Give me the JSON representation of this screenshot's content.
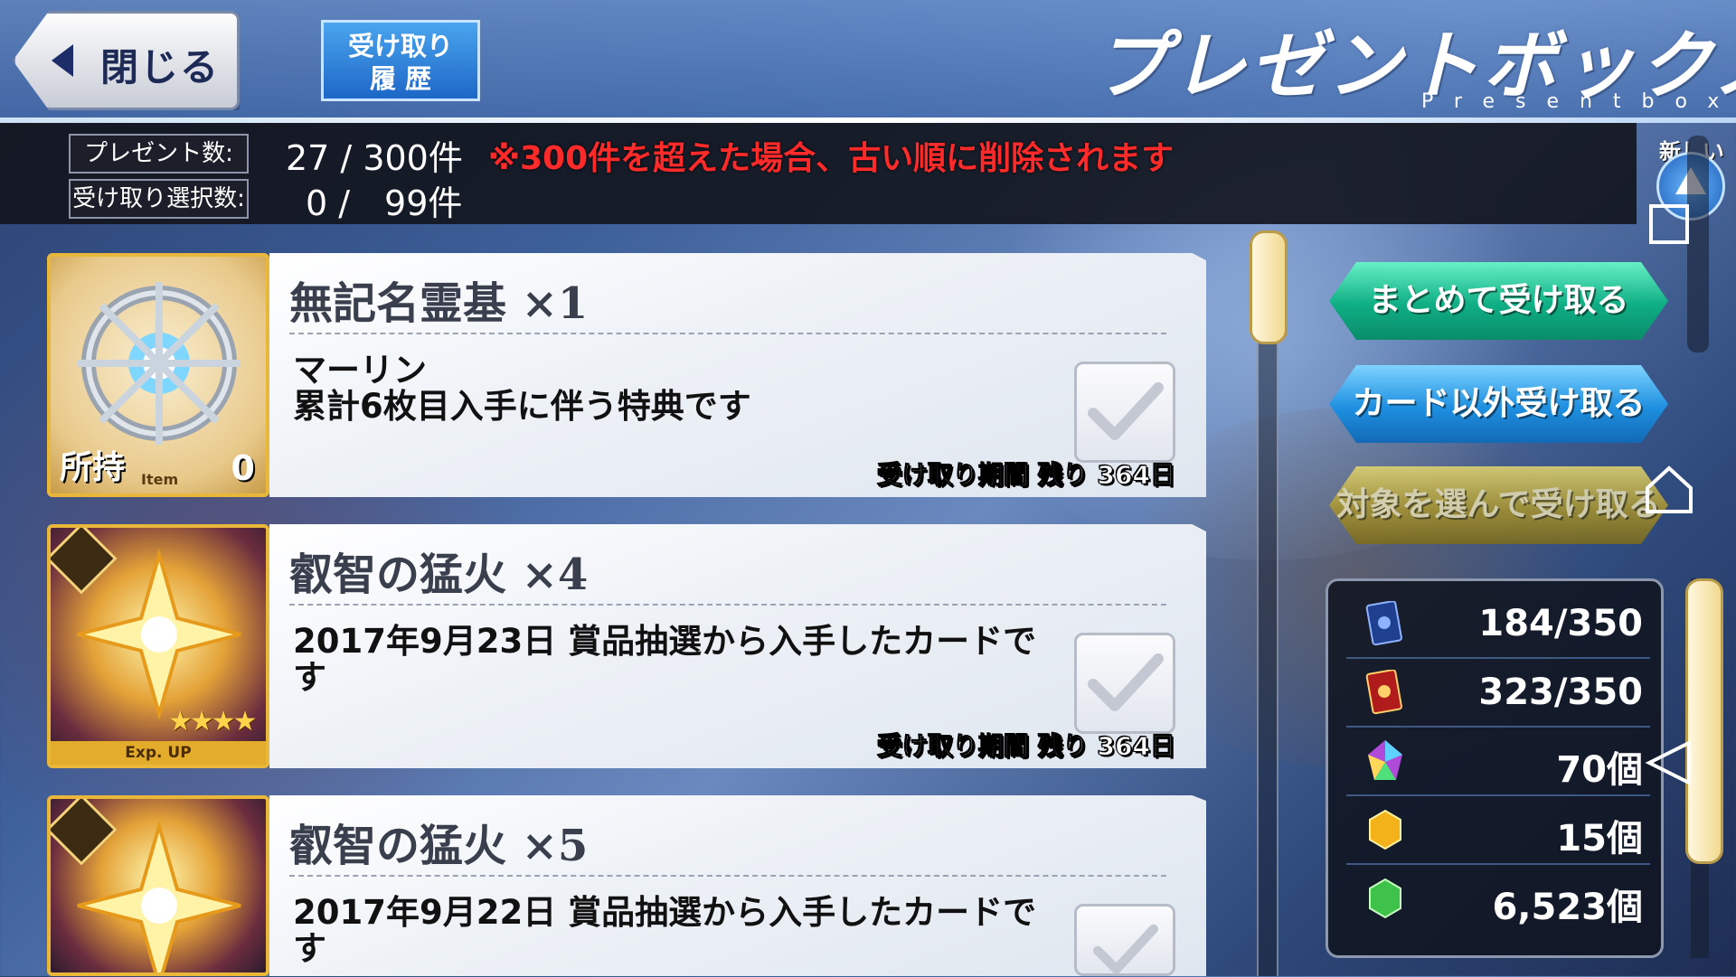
{
  "header": {
    "close_label": "閉じる",
    "history_label_line1": "受け取り",
    "history_label_line2": "履 歴",
    "title": "プレゼントボックス",
    "subtitle": "Presentbox"
  },
  "info": {
    "present_count_label": "プレゼント数:",
    "present_count_value": "27 / 300件",
    "warning": "※300件を超えた場合、古い順に削除されます",
    "selected_count_label": "受け取り選択数:",
    "selected_count_value": "0 /　99件"
  },
  "sort": {
    "label": "新しい順"
  },
  "items": [
    {
      "name": "無記名霊基 ×1",
      "description": "マーリン\n累計6枚目入手に伴う特典です",
      "deadline": "受け取り期間 残り 364日",
      "own_label": "所持",
      "own_count": "0",
      "tag": "Item",
      "type": "item"
    },
    {
      "name": "叡智の猛火 ×4",
      "description": "2017年9月23日 賞品抽選から入手したカードです",
      "deadline": "受け取り期間 残り 364日",
      "tag": "Exp. UP",
      "stars": "★★★★",
      "type": "card"
    },
    {
      "name": "叡智の猛火 ×5",
      "description": "2017年9月22日 賞品抽選から入手したカードです",
      "type": "card"
    }
  ],
  "actions": {
    "receive_all": "まとめて受け取る",
    "receive_non_card": "カード以外受け取る",
    "receive_selected": "対象を選んで受け取る"
  },
  "inventory": [
    {
      "icon": "servant-card-icon",
      "value": "184/350",
      "color": "#1f3f8f"
    },
    {
      "icon": "craft-essence-card-icon",
      "value": "323/350",
      "color": "#b01c1c"
    },
    {
      "icon": "saint-quartz-icon",
      "value": "70個",
      "color": "#b04ad8"
    },
    {
      "icon": "golden-fruit-icon",
      "value": "15個",
      "color": "#f3b21a"
    },
    {
      "icon": "mana-prism-icon",
      "value": "6,523個",
      "color": "#3fc24a"
    }
  ]
}
